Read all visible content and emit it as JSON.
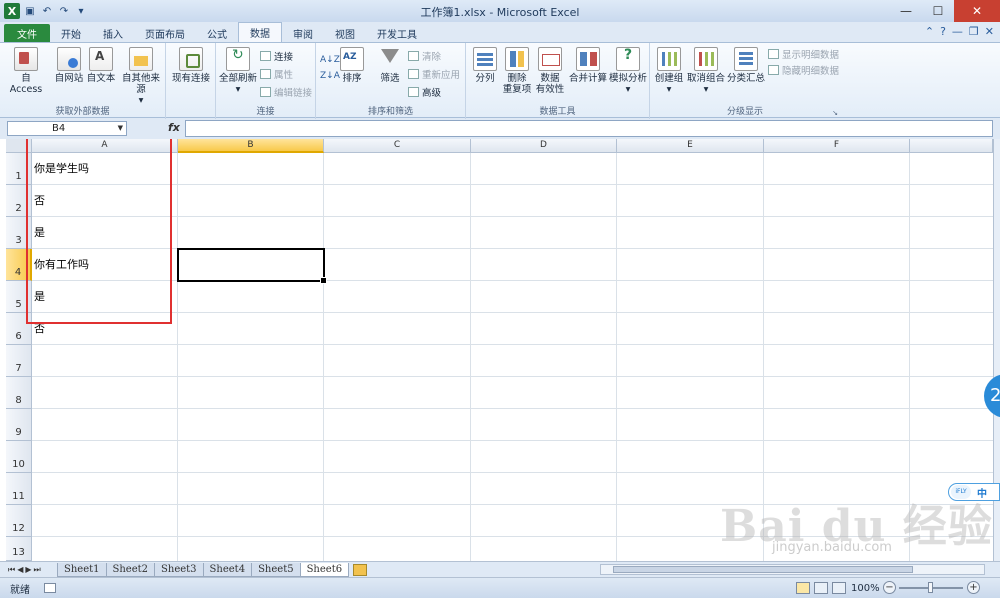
{
  "window": {
    "title": "工作簿1.xlsx - Microsoft Excel",
    "app_icon": "X"
  },
  "tabs": [
    {
      "label": "文件",
      "kind": "file"
    },
    {
      "label": "开始"
    },
    {
      "label": "插入"
    },
    {
      "label": "页面布局"
    },
    {
      "label": "公式"
    },
    {
      "label": "数据",
      "active": true
    },
    {
      "label": "审阅"
    },
    {
      "label": "视图"
    },
    {
      "label": "开发工具"
    }
  ],
  "ribbon": {
    "groups": {
      "external": "获取外部数据",
      "connections": "连接",
      "sortfilter": "排序和筛选",
      "datatools": "数据工具",
      "outline": "分级显示"
    },
    "buttons": {
      "access": "自 Access",
      "web": "自网站",
      "text": "自文本",
      "other": "自其他来源",
      "existing": "现有连接",
      "refresh_all": "全部刷新",
      "connections": "连接",
      "properties": "属性",
      "edit_links": "编辑链接",
      "sort": "排序",
      "filter": "筛选",
      "clear": "清除",
      "reapply": "重新应用",
      "advanced": "高级",
      "text_to_columns": "分列",
      "remove_dup_1": "删除",
      "remove_dup_2": "重复项",
      "validation_1": "数据",
      "validation_2": "有效性",
      "consolidate": "合并计算",
      "whatif": "模拟分析",
      "group": "创建组",
      "ungroup": "取消组合",
      "subtotal": "分类汇总",
      "show_detail": "显示明细数据",
      "hide_detail": "隐藏明细数据"
    }
  },
  "formula_bar": {
    "name_box": "B4",
    "fx": "fx",
    "content": ""
  },
  "sheet": {
    "columns": [
      "A",
      "B",
      "C",
      "D",
      "E",
      "F"
    ],
    "selected_column": "B",
    "rows": [
      "1",
      "2",
      "3",
      "4",
      "5",
      "6",
      "7",
      "8",
      "9",
      "10",
      "11",
      "12",
      "13"
    ],
    "selected_row": "4",
    "cells_col_a": [
      "你是学生吗",
      "否",
      "是",
      "你有工作吗",
      "是",
      "否"
    ]
  },
  "sheet_tabs": [
    "Sheet1",
    "Sheet2",
    "Sheet3",
    "Sheet4",
    "Sheet5",
    "Sheet6"
  ],
  "active_sheet": "Sheet6",
  "status": {
    "ready": "就绪",
    "zoom": "100%"
  },
  "ime": {
    "logo": "iFLY",
    "mode": "中"
  },
  "side_badge": "2",
  "watermark": {
    "brand": "Bai du 经验",
    "url": "jingyan.baidu.com"
  }
}
